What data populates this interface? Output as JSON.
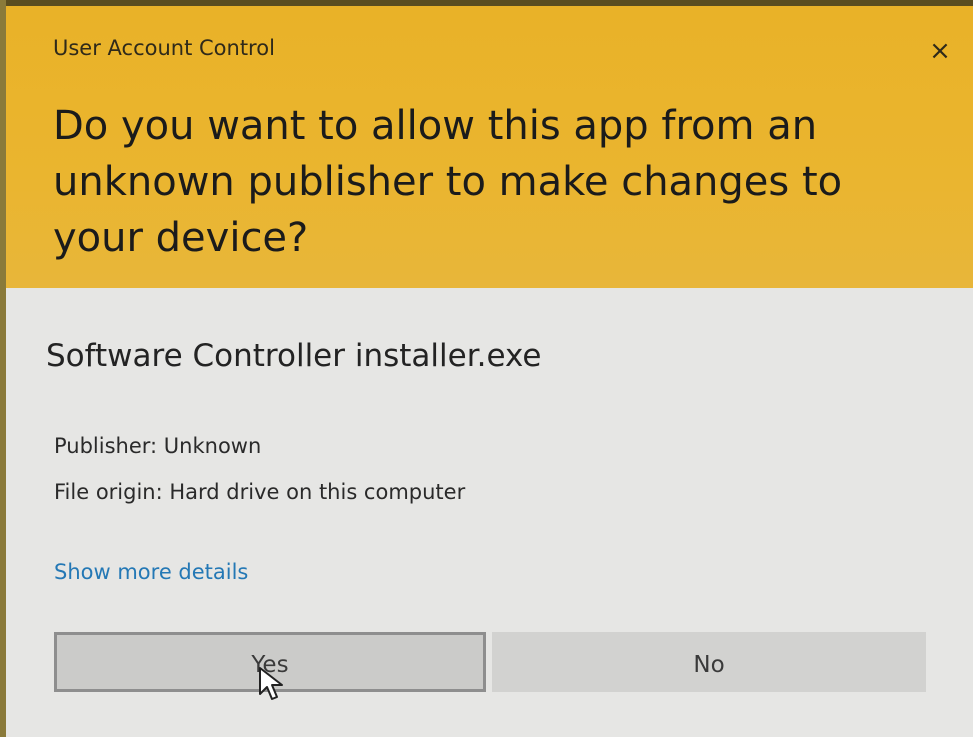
{
  "window": {
    "title": "User Account Control",
    "close_symbol": "×"
  },
  "prompt": {
    "question": "Do you want to allow this app from an unknown publisher to make changes to your device?"
  },
  "app": {
    "name": "Software Controller installer.exe",
    "publisher": "Publisher: Unknown",
    "origin": "File origin: Hard drive on this computer",
    "more_details": "Show more details"
  },
  "buttons": {
    "yes": "Yes",
    "no": "No"
  },
  "colors": {
    "header": "#e9b228",
    "body": "#e6e6e4",
    "link": "#2478b5"
  },
  "icons": {
    "close": "close-icon",
    "cursor": "mouse-pointer-icon"
  }
}
